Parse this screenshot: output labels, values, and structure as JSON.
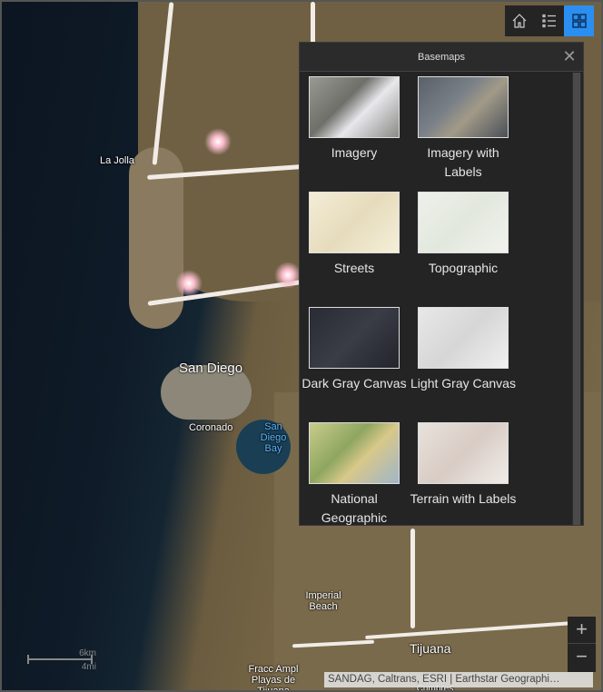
{
  "map": {
    "labels": [
      "La Jolla",
      "San Diego",
      "Coronado",
      "San Diego Bay",
      "Imperial Beach",
      "Tijuana",
      "Fracc Ampl Playas de Tijuana",
      "Presa Cumbres"
    ],
    "scale": {
      "km": "6km",
      "mi": "4mi"
    },
    "attribution": "SANDAG, Caltrans, ESRI | Earthstar Geographi…"
  },
  "widgets": [
    {
      "icon": "home-icon"
    },
    {
      "icon": "legend-list-icon"
    },
    {
      "icon": "basemap-gallery-icon",
      "active": true
    }
  ],
  "accent": "#2a8ff0",
  "panel": {
    "title": "Basemaps",
    "close_icon": "close-icon",
    "items": [
      {
        "label": "Imagery"
      },
      {
        "label": "Imagery with Labels"
      },
      {
        "label": "Streets"
      },
      {
        "label": "Topographic"
      },
      {
        "label": "Dark Gray Canvas"
      },
      {
        "label": "Light Gray Canvas"
      },
      {
        "label": "National Geographic"
      },
      {
        "label": "Terrain with Labels"
      }
    ]
  },
  "zoom": {
    "in": "+",
    "out": "−"
  }
}
